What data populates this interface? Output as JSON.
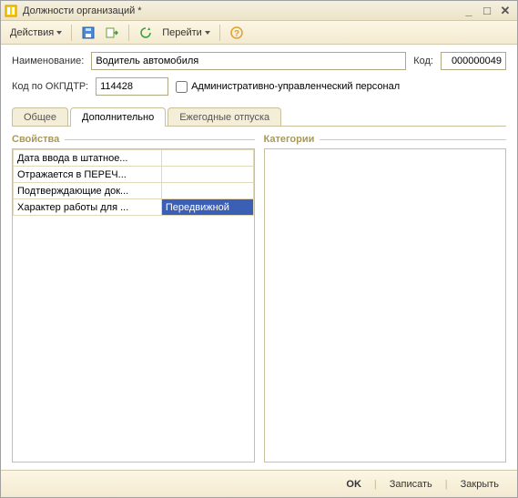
{
  "window": {
    "title": "Должности организаций *"
  },
  "toolbar": {
    "actions_label": "Действия",
    "goto_label": "Перейти"
  },
  "form": {
    "name_label": "Наименование:",
    "name_value": "Водитель автомобиля",
    "code_label": "Код:",
    "code_value": "000000049",
    "okpdtr_label": "Код по ОКПДТР:",
    "okpdtr_value": "114428",
    "admin_checkbox_label": "Административно-управленческий персонал",
    "admin_checked": false
  },
  "tabs": [
    {
      "label": "Общее",
      "active": false
    },
    {
      "label": "Дополнительно",
      "active": true
    },
    {
      "label": "Ежегодные отпуска",
      "active": false
    }
  ],
  "detail_tab": {
    "properties_title": "Свойства",
    "categories_title": "Категории",
    "properties": [
      {
        "name": "Дата ввода в штатное...",
        "value": ""
      },
      {
        "name": "Отражается в ПЕРЕЧ...",
        "value": ""
      },
      {
        "name": "Подтверждающие док...",
        "value": ""
      },
      {
        "name": "Характер работы для ...",
        "value": "Передвижной",
        "selected": true
      }
    ]
  },
  "footer": {
    "ok": "OK",
    "write": "Записать",
    "close": "Закрыть"
  }
}
